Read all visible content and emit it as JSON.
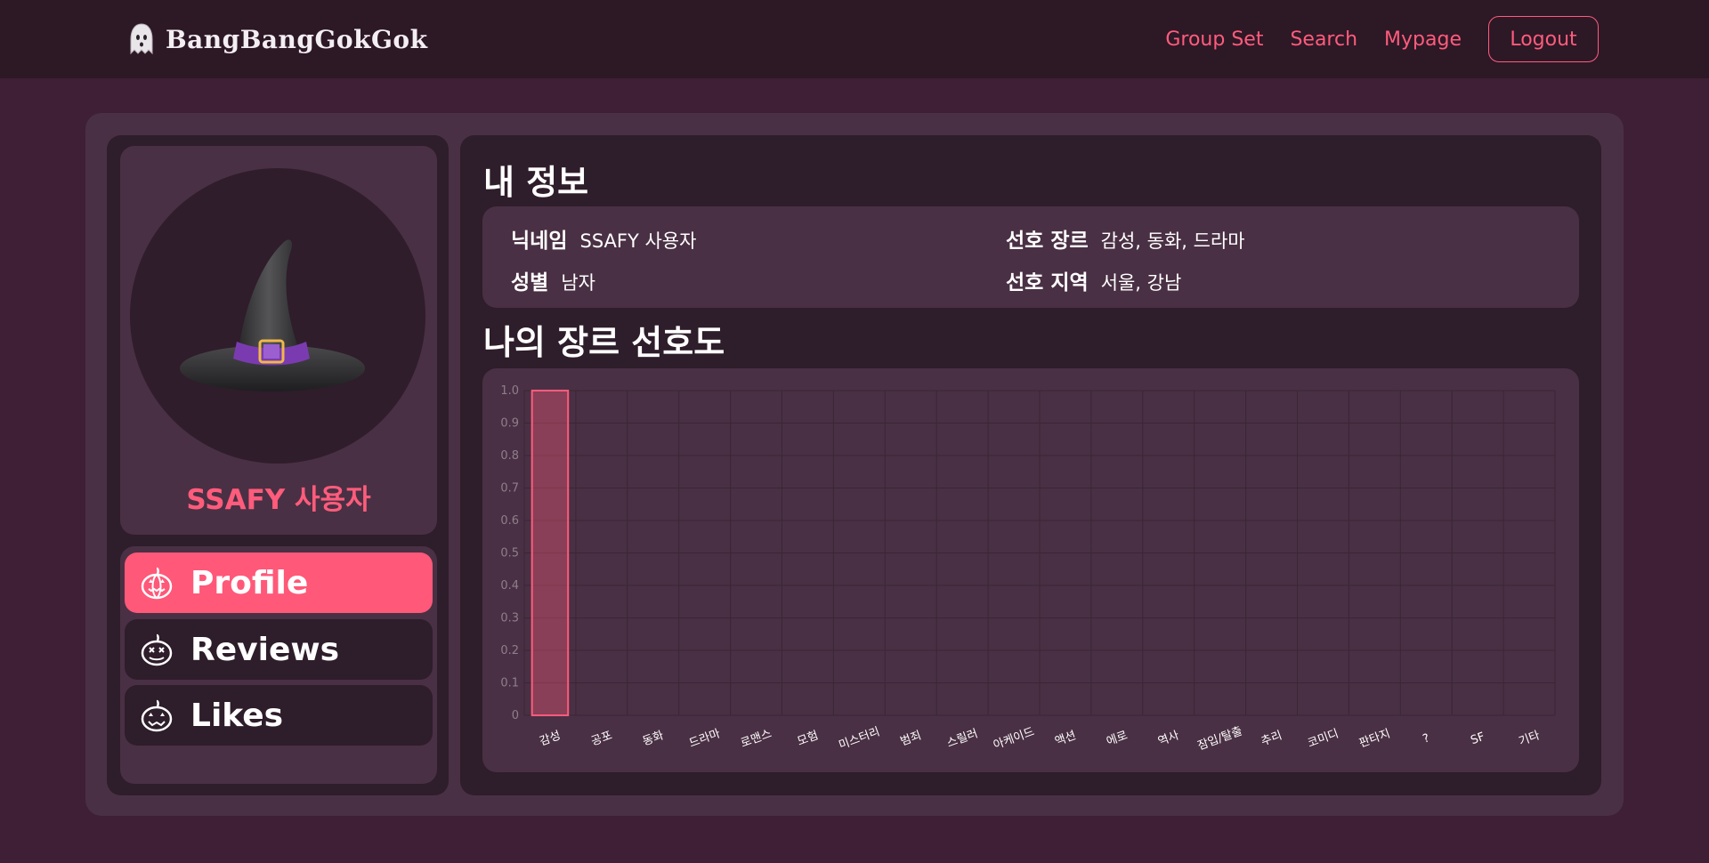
{
  "header": {
    "brand": "BangBangGokGok",
    "nav": [
      "Group Set",
      "Search",
      "Mypage"
    ],
    "logout_label": "Logout"
  },
  "profile": {
    "name": "SSAFY 사용자"
  },
  "menu": [
    {
      "label": "Profile",
      "active": true,
      "icon": "pumpkin-icon"
    },
    {
      "label": "Reviews",
      "active": false,
      "icon": "pumpkin-icon"
    },
    {
      "label": "Likes",
      "active": false,
      "icon": "pumpkin-icon"
    }
  ],
  "info": {
    "title": "내 정보",
    "nickname_label": "닉네임",
    "nickname_value": "SSAFY 사용자",
    "gender_label": "성별",
    "gender_value": "남자",
    "genre_label": "선호 장르",
    "genre_value": "감성, 동화, 드라마",
    "region_label": "선호 지역",
    "region_value": "서울, 강남"
  },
  "genre_section": {
    "title": "나의 장르 선호도"
  },
  "colors": {
    "accent": "#ff5c7c",
    "background": "#3e1f35",
    "panel": "#2e1d2a",
    "card": "#4a3044"
  },
  "chart_data": {
    "type": "bar",
    "categories": [
      "감성",
      "공포",
      "동화",
      "드라마",
      "로맨스",
      "모험",
      "미스터리",
      "범죄",
      "스릴러",
      "아케이드",
      "액션",
      "에로",
      "역사",
      "잠입/탈출",
      "추리",
      "코미디",
      "판타지",
      "?",
      "SF",
      "기타"
    ],
    "values": [
      1,
      0,
      0,
      0,
      0,
      0,
      0,
      0,
      0,
      0,
      0,
      0,
      0,
      0,
      0,
      0,
      0,
      0,
      0,
      0
    ],
    "ylim": [
      0,
      1
    ],
    "yticks": [
      "0",
      "0.1",
      "0.2",
      "0.3",
      "0.4",
      "0.5",
      "0.6",
      "0.7",
      "0.8",
      "0.9",
      "1.0"
    ],
    "grid": true,
    "bar_color": "#ff5c7c"
  }
}
